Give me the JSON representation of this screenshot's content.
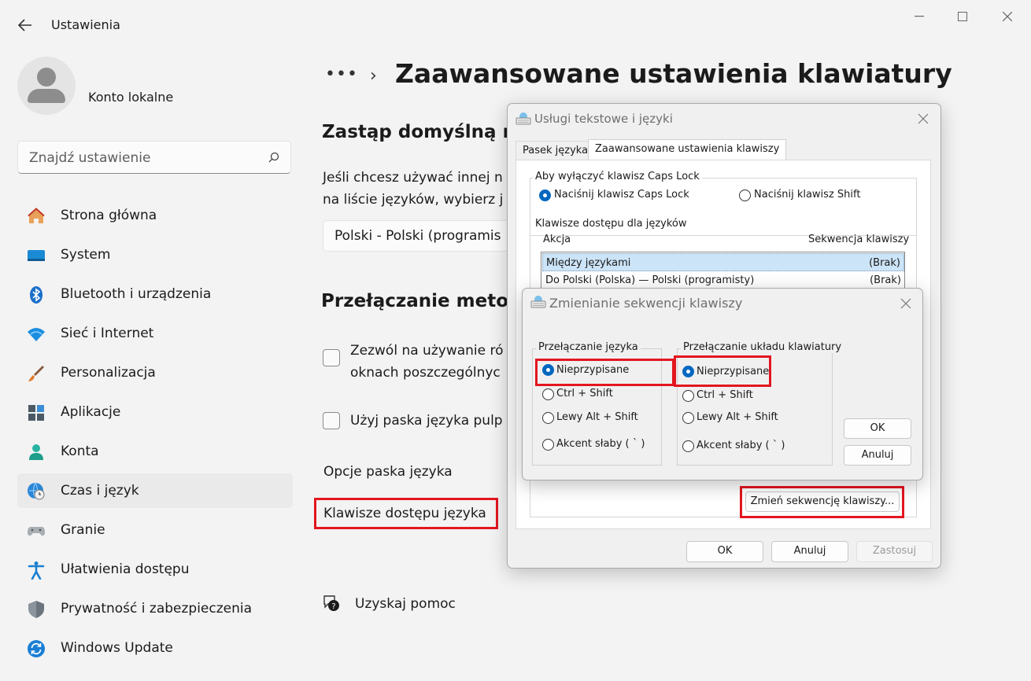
{
  "app": {
    "title": "Ustawienia",
    "back_icon": "back-arrow-icon",
    "window_controls": [
      "minimize-icon",
      "maximize-icon",
      "close-icon"
    ]
  },
  "profile": {
    "name": "Konto lokalne"
  },
  "search": {
    "placeholder": "Znajdź ustawienie",
    "icon": "search-icon"
  },
  "nav": {
    "items": [
      {
        "label": "Strona główna",
        "icon": "home-icon"
      },
      {
        "label": "System",
        "icon": "system-icon"
      },
      {
        "label": "Bluetooth i urządzenia",
        "icon": "bluetooth-icon"
      },
      {
        "label": "Sieć i Internet",
        "icon": "wifi-icon"
      },
      {
        "label": "Personalizacja",
        "icon": "brush-icon"
      },
      {
        "label": "Aplikacje",
        "icon": "apps-icon"
      },
      {
        "label": "Konta",
        "icon": "account-icon"
      },
      {
        "label": "Czas i język",
        "icon": "time-language-icon"
      },
      {
        "label": "Granie",
        "icon": "gamepad-icon"
      },
      {
        "label": "Ułatwienia dostępu",
        "icon": "accessibility-icon"
      },
      {
        "label": "Prywatność i zabezpieczenia",
        "icon": "shield-icon"
      },
      {
        "label": "Windows Update",
        "icon": "update-icon"
      }
    ],
    "active": "Czas i język"
  },
  "main": {
    "breadcrumb_dots": "•••",
    "breadcrumb_separator": "›",
    "title": "Zaawansowane ustawienia klawiatury",
    "section1": {
      "title": "Zastąp domyślną m",
      "text_line1": "Jeśli chcesz używać innej n",
      "text_line2": "na liście języków, wybierz j",
      "dropdown_value": "Polski - Polski (programis"
    },
    "section2": {
      "title": "Przełączanie metoc",
      "checkbox1_line1": "Zezwól na używanie ró",
      "checkbox1_line2": "oknach poszczególnyc",
      "checkbox2": "Użyj paska języka pulp"
    },
    "link_language_bar": "Opcje paska języka",
    "link_hotkeys": "Klawisze dostępu języka",
    "help": "Uzyskaj pomoc"
  },
  "dialog1": {
    "title": "Usługi tekstowe i języki",
    "tabs": [
      "Pasek języka",
      "Zaawansowane ustawienia klawiszy"
    ],
    "capslock_group": "Aby wyłączyć klawisz Caps Lock",
    "capslock_options": [
      "Naciśnij klawisz Caps Lock",
      "Naciśnij klawisz Shift"
    ],
    "hotkeys_group": "Klawisze dostępu dla języków",
    "col_action": "Akcja",
    "col_sequence": "Sekwencja klawiszy",
    "rows": [
      {
        "action": "Między językami",
        "sequence": "(Brak)"
      },
      {
        "action": "Do Polski (Polska) — Polski (programisty)",
        "sequence": "(Brak)"
      }
    ],
    "change_btn": "Zmień sekwencję klawiszy...",
    "ok": "OK",
    "cancel": "Anuluj",
    "apply": "Zastosuj"
  },
  "dialog2": {
    "title": "Zmienianie sekwencji klawiszy",
    "group_lang": "Przełączanie języka",
    "group_layout": "Przełączanie układu klawiatury",
    "options": [
      "Nieprzypisane",
      "Ctrl + Shift",
      "Lewy Alt + Shift",
      "Akcent słaby ( ` )"
    ],
    "ok": "OK",
    "cancel": "Anuluj"
  },
  "colors": {
    "accent": "#0067c0",
    "highlight_red": "#e3161f",
    "selection": "#cce4f7"
  }
}
